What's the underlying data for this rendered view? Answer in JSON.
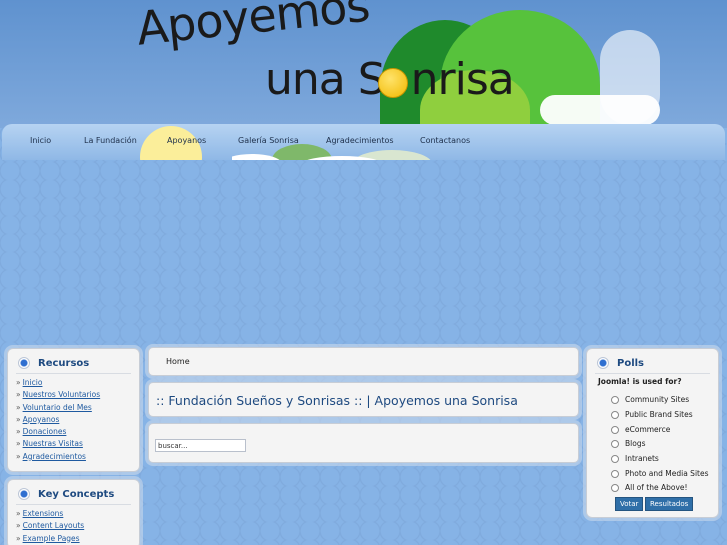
{
  "header": {
    "logo_line1": "Apoyemos",
    "logo_line2": "una S",
    "logo_line2b": "nrisa"
  },
  "nav": {
    "items": [
      "Inicio",
      "La Fundación",
      "Apoyanos",
      "Galería Sonrisa",
      "Agradecimientos",
      "Contactanos"
    ]
  },
  "recursos": {
    "title": "Recursos",
    "items": [
      "Inicio",
      "Nuestros Voluntarios",
      "Voluntario del Mes",
      "Apoyanos",
      "Donaciones",
      "Nuestras Visitas",
      "Agradecimientos"
    ]
  },
  "key_concepts": {
    "title": "Key Concepts",
    "items": [
      "Extensions",
      "Content Layouts",
      "Example Pages"
    ]
  },
  "breadcrumb": {
    "home": "Home"
  },
  "page": {
    "heading": ":: Fundación Sueños y Sonrisas :: | Apoyemos una Sonrisa"
  },
  "search": {
    "placeholder": "buscar..."
  },
  "polls": {
    "title": "Polls",
    "question": "Joomla! is used for?",
    "options": [
      "Community Sites",
      "Public Brand Sites",
      "eCommerce",
      "Blogs",
      "Intranets",
      "Photo and Media Sites",
      "All of the Above!"
    ],
    "vote_label": "Votar",
    "results_label": "Resultados"
  },
  "colors": {
    "accent": "#1e4a80",
    "link": "#1f5aa0",
    "button": "#2f6fa8",
    "sun": "#fbee9a",
    "hill_green": "#4fae3a"
  }
}
